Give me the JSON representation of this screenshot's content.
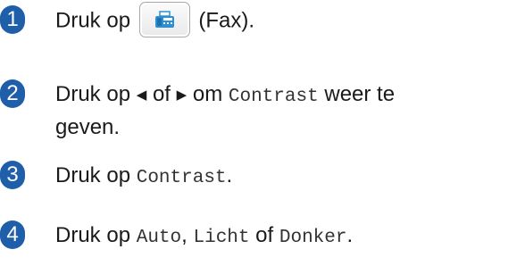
{
  "steps": [
    {
      "number": "1",
      "prefix": "Druk op",
      "button_label": "(Fax).",
      "button_icon": "fax-icon"
    },
    {
      "number": "2",
      "text_a": "Druk op",
      "left_arrow": "◀",
      "text_b": "of",
      "right_arrow": "▶",
      "text_c": "om",
      "code_contrast": "Contrast",
      "text_d": "weer te",
      "text_e": "geven."
    },
    {
      "number": "3",
      "text_a": "Druk op",
      "code_contrast": "Contrast",
      "text_b": "."
    },
    {
      "number": "4",
      "text_a": "Druk op",
      "code_auto": "Auto",
      "text_b": ",",
      "code_licht": "Licht",
      "text_c": "of",
      "code_donker": "Donker",
      "text_d": "."
    }
  ],
  "colors": {
    "step_badge": "#1f5ea8",
    "fax_icon": "#2b8fd6"
  }
}
